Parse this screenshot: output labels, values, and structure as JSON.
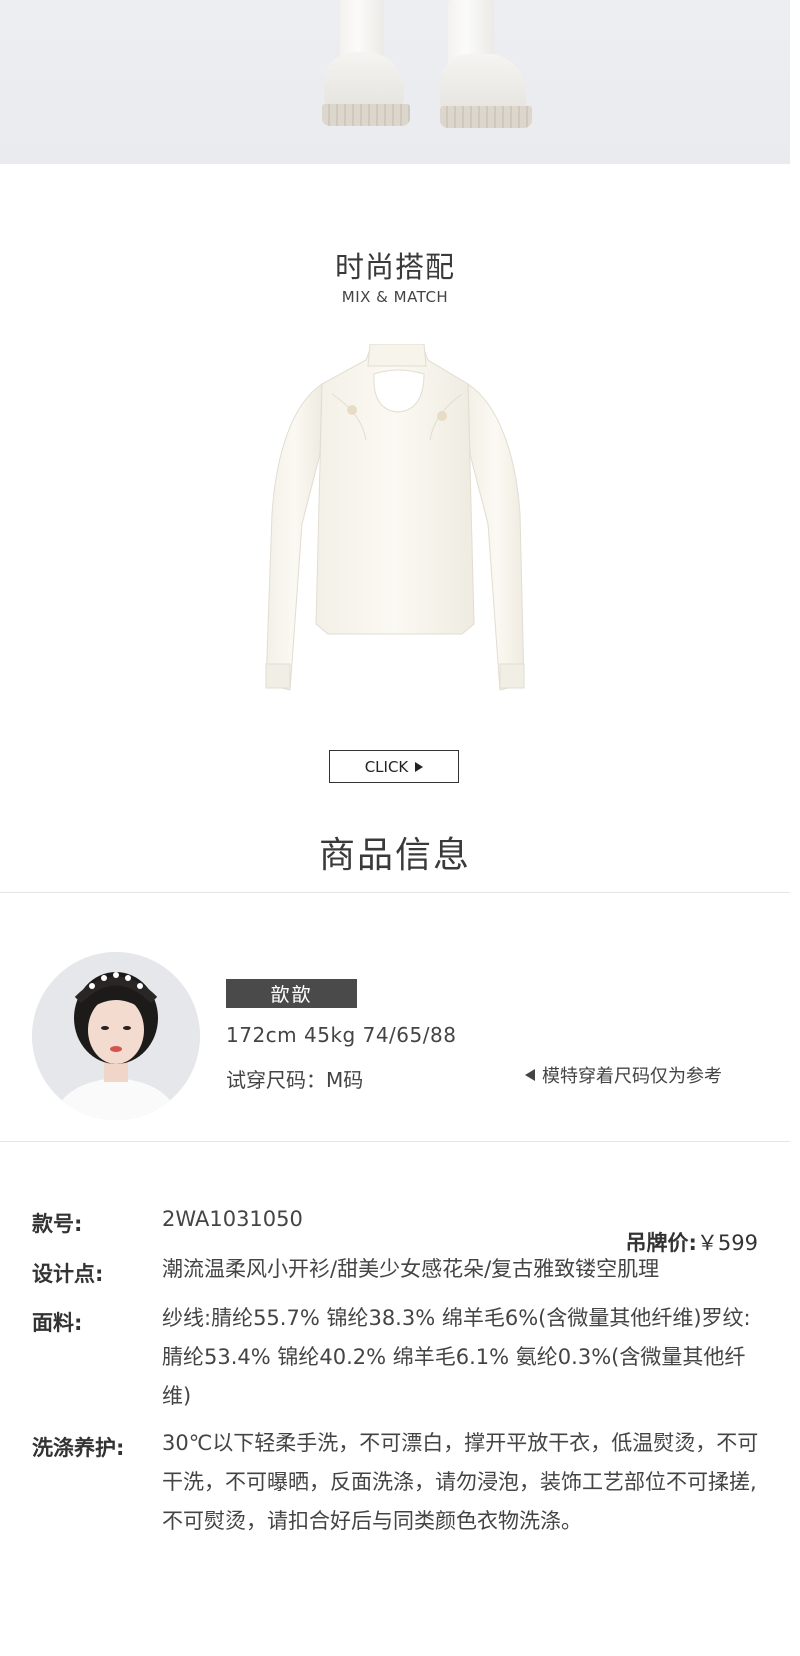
{
  "hero": {
    "image": "model-legs-white-boots"
  },
  "mix_match": {
    "title_cn": "时尚搭配",
    "title_en": "MIX & MATCH",
    "product_image": "white-knit-cardigan",
    "click_label": "CLICK"
  },
  "product_info": {
    "title": "商品信息",
    "model": {
      "name": "歆歆",
      "stats": "172cm  45kg  74/65/88",
      "try_size": "试穿尺码：M码",
      "note": "模特穿着尺码仅为参考"
    },
    "specs": [
      {
        "label": "款号:",
        "value": "2WA1031050"
      },
      {
        "label": "设计点:",
        "value": "潮流温柔风小开衫/甜美少女感花朵/复古雅致镂空肌理"
      },
      {
        "label": "面料:",
        "value": "纱线:腈纶55.7% 锦纶38.3% 绵羊毛6%(含微量其他纤维)罗纹:腈纶53.4% 锦纶40.2% 绵羊毛6.1% 氨纶0.3%(含微量其他纤维)"
      },
      {
        "label": "洗涤养护:",
        "value": "30℃以下轻柔手洗，不可漂白，撑开平放干衣，低温熨烫，不可干洗，不可曝晒，反面洗涤，请勿浸泡，装饰工艺部位不可揉搓,不可熨烫，请扣合好后与同类颜色衣物洗涤。"
      }
    ],
    "price_label": "吊牌价:",
    "price_value": "￥599"
  }
}
